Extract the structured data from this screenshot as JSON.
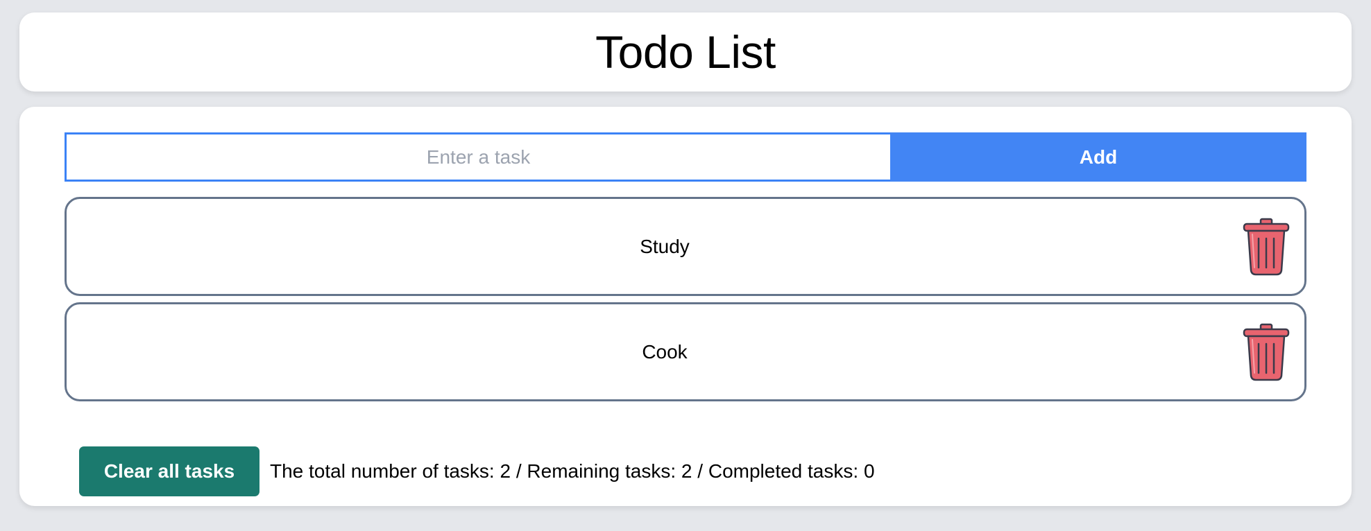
{
  "header": {
    "title": "Todo List"
  },
  "input": {
    "placeholder": "Enter a task",
    "value": ""
  },
  "add_button": {
    "label": "Add"
  },
  "tasks": [
    {
      "label": "Study",
      "icon": "trash-can-icon"
    },
    {
      "label": "Cook",
      "icon": "trash-can-icon"
    }
  ],
  "footer": {
    "clear_label": "Clear all tasks",
    "stats_text": "The total number of tasks: 2 / Remaining tasks: 2 / Completed tasks: 0"
  },
  "colors": {
    "accent": "#4285f4",
    "clear_button": "#1b7a6e",
    "trash": "#e8646f",
    "border": "#64748b",
    "background": "#e5e7eb"
  }
}
